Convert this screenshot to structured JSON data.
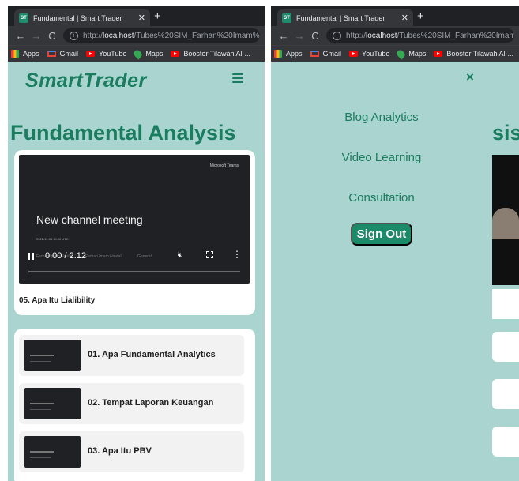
{
  "browser": {
    "tab_title": "Fundamental | Smart Trader",
    "favicon_text": "ST",
    "url_host": "localhost",
    "url_path_left": "/Tubes%20SIM_Farhan%20Imam%20",
    "url_path_right": "/Tubes%20SIM_Farhan%20Imam%",
    "bookmarks": [
      "Apps",
      "Gmail",
      "YouTube",
      "Maps",
      "Booster Tilawah Al-..."
    ]
  },
  "site": {
    "brand": "SmartTrader",
    "page_title": "Fundamental Analysis",
    "page_title_partial": "sis",
    "colors": {
      "brand_green": "#1a7d5f",
      "background": "#a9d4cf"
    }
  },
  "player": {
    "brand_overlay": "Microsoft Teams",
    "video_title": "New channel meeting",
    "video_date": "2021-11-01 19:00 UTC",
    "meta_1": "Farhan Imam Naufal",
    "meta_2": "Farhan Imam Naufal",
    "meta_3": "General",
    "time": "0:00 / 2:12",
    "caption": "05. Apa Itu Lialibility",
    "progress": 0
  },
  "playlist": [
    {
      "label": "01. Apa Fundamental Analytics"
    },
    {
      "label": "02. Tempat Laporan Keuangan"
    },
    {
      "label": "03. Apa Itu PBV"
    }
  ],
  "menu": {
    "close": "×",
    "items": [
      "Blog Analytics",
      "Video Learning",
      "Consultation"
    ],
    "signout": "Sign Out"
  }
}
